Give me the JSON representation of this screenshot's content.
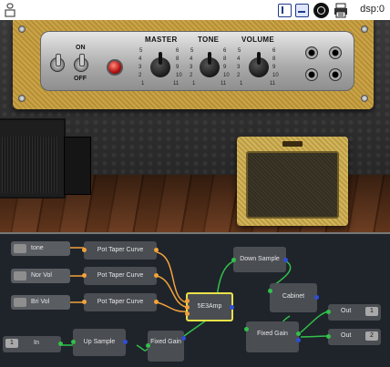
{
  "toolbar": {
    "dsp_label": "dsp:0",
    "buttons": [
      "split-view-icon",
      "bottom-view-icon",
      "record-icon",
      "print-icon"
    ]
  },
  "amp_panel": {
    "switch_on": "ON",
    "switch_off": "OFF",
    "knobs": [
      {
        "label": "MASTER"
      },
      {
        "label": "TONE"
      },
      {
        "label": "VOLUME"
      }
    ],
    "scale_left": [
      "5",
      "4",
      "3",
      "2",
      "1"
    ],
    "scale_right": [
      "6",
      "8",
      "9",
      "10",
      "11",
      "12"
    ]
  },
  "patch": {
    "nodes": {
      "tone": "tone",
      "nor_vol": "Nor Vol",
      "bri_vol": "Bri Vol",
      "pot1": "Pot Taper Curve",
      "pot2": "Pot Taper Curve",
      "pot3": "Pot Taper Curve",
      "down_sample": "Down Sample",
      "se3amp": "5E3Amp",
      "cabinet": "Cabinet",
      "in_tag": "1",
      "in_label": "In",
      "up_sample": "Up Sample",
      "fixed_gain_1": "Fixed Gain",
      "fixed_gain_2": "Fixed Gain",
      "out1_label": "Out",
      "out1_tag": "1",
      "out2_label": "Out",
      "out2_tag": "2"
    },
    "colors": {
      "control_wire": "#f3a23a",
      "audio_wire": "#32c04a",
      "selected_border": "#e8e24a",
      "background": "#1f242b"
    }
  }
}
